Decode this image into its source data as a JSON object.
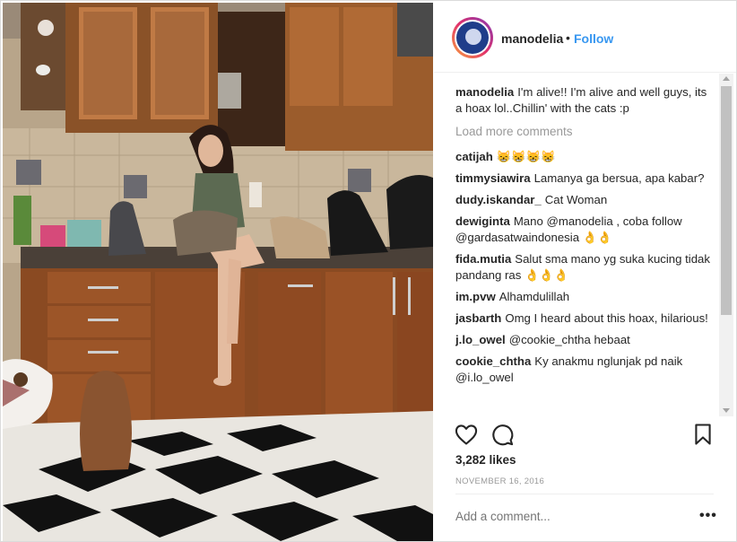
{
  "post": {
    "username": "manodelia",
    "separator": "•",
    "follow_label": "Follow",
    "likes": "3,282 likes",
    "date": "NOVEMBER 16, 2016",
    "add_comment_placeholder": "Add a comment...",
    "more_label": "•••"
  },
  "caption": {
    "user": "manodelia",
    "text": "I'm alive!! I'm alive and well guys, its a hoax lol..Chillin' with the cats :p"
  },
  "load_more": "Load more comments",
  "comments": [
    {
      "user": "catijah",
      "parts": [
        {
          "text": "😸😸😸😸",
          "mention": false
        }
      ]
    },
    {
      "user": "timmysiawira",
      "parts": [
        {
          "text": "Lamanya ga bersua, apa kabar?",
          "mention": false
        }
      ]
    },
    {
      "user": "dudy.iskandar_",
      "parts": [
        {
          "text": "Cat Woman",
          "mention": false
        }
      ]
    },
    {
      "user": "dewiginta",
      "parts": [
        {
          "text": "Mano ",
          "mention": false
        },
        {
          "text": "@manodelia",
          "mention": true
        },
        {
          "text": " , coba follow ",
          "mention": false
        },
        {
          "text": "@gardasatwaindonesia",
          "mention": true
        },
        {
          "text": " 👌👌",
          "mention": false
        }
      ]
    },
    {
      "user": "fida.mutia",
      "parts": [
        {
          "text": "Salut sma mano yg suka kucing tidak pandang ras 👌👌👌",
          "mention": false
        }
      ]
    },
    {
      "user": "im.pvw",
      "parts": [
        {
          "text": "Alhamdulillah",
          "mention": false
        }
      ]
    },
    {
      "user": "jasbarth",
      "parts": [
        {
          "text": "Omg I heard about this hoax, hilarious!",
          "mention": false
        }
      ]
    },
    {
      "user": "j.lo_owel",
      "parts": [
        {
          "text": "@cookie_chtha",
          "mention": true
        },
        {
          "text": " hebaat",
          "mention": false
        }
      ]
    },
    {
      "user": "cookie_chtha",
      "parts": [
        {
          "text": "Ky anakmu nglunjak pd naik ",
          "mention": false
        },
        {
          "text": "@i.lo_owel",
          "mention": true
        }
      ]
    }
  ],
  "icons": [
    "heart-icon",
    "comment-icon",
    "bookmark-icon",
    "scroll-up-icon",
    "scroll-down-icon"
  ],
  "colors": {
    "link": "#3897f0",
    "mention": "#003569",
    "muted": "#999999",
    "text": "#262626"
  }
}
